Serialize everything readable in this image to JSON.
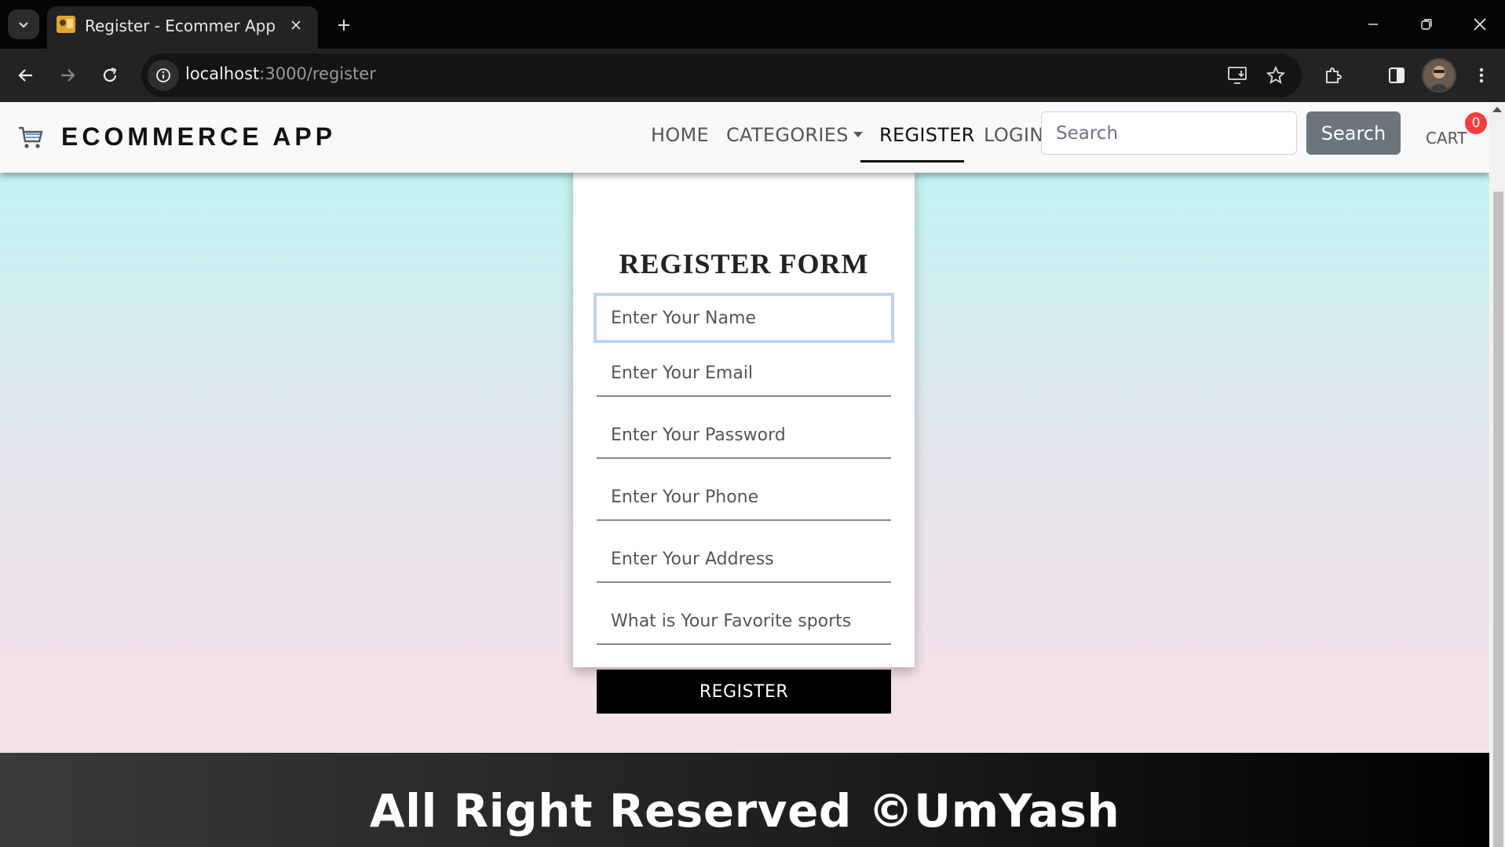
{
  "browser": {
    "tab_title": "Register - Ecommer App",
    "url_host": "localhost",
    "url_path": ":3000/register",
    "icons": [
      "tab-list-icon",
      "close-icon",
      "plus-icon",
      "minimize-icon",
      "restore-icon",
      "back-arrow-icon",
      "forward-arrow-icon",
      "reload-icon",
      "info-icon",
      "install-app-icon",
      "star-icon",
      "extensions-icon",
      "side-panel-icon",
      "menu-dots-icon"
    ]
  },
  "site": {
    "brand": "ECOMMERCE APP",
    "nav": {
      "home": "HOME",
      "categories": "CATEGORIES",
      "register": "REGISTER",
      "login": "LOGIN"
    },
    "search": {
      "placeholder": "Search",
      "button": "Search"
    },
    "cart": {
      "label": "CART",
      "count": "0"
    }
  },
  "form": {
    "title": "REGISTER FORM",
    "name_placeholder": "Enter Your Name",
    "email_placeholder": "Enter Your Email",
    "password_placeholder": "Enter Your Password",
    "phone_placeholder": "Enter Your Phone",
    "address_placeholder": "Enter Your Address",
    "answer_placeholder": "What is Your Favorite sports",
    "submit": "REGISTER"
  },
  "footer": {
    "text": "All Right Reserved ©UmYash"
  },
  "colors": {
    "gradient_top": "#b9f7f4",
    "gradient_bottom": "#fde0e8",
    "cart_badge": "#ff3b3b",
    "search_button": "#6c757d"
  }
}
